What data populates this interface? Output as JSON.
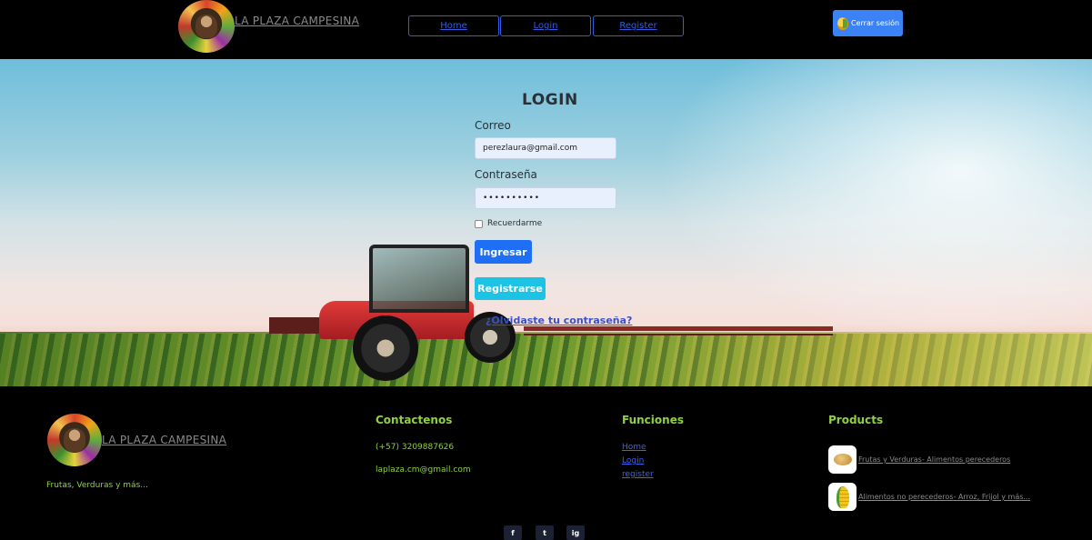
{
  "header": {
    "brand": "LA PLAZA CAMPESINA",
    "nav": {
      "home": "Home",
      "login": "Login",
      "register": "Register"
    },
    "logout_label": "Cerrar sesión"
  },
  "login": {
    "title": "LOGIN",
    "email_label": "Correo",
    "email_value": "perezlaura@gmail.com",
    "password_label": "Contraseña",
    "password_value": "••••••••••",
    "remember_label": "Recuerdarme",
    "submit_label": "Ingresar",
    "register_label": "Registrarse",
    "forgot_label": "¿Olvidaste tu contraseña?"
  },
  "footer": {
    "brand": "LA PLAZA CAMPESINA",
    "tagline": "Frutas, Verduras y más...",
    "contact": {
      "heading": "Contactenos",
      "phone": "(+57) 3209887626",
      "email": "laplaza.cm@gmail.com"
    },
    "functions": {
      "heading": "Funciones",
      "links": [
        "Home",
        "Login",
        "register"
      ]
    },
    "products": {
      "heading": "Products",
      "items": [
        {
          "label": "Frutas y Verduras- Alimentos perecederos",
          "icon": "potato-icon"
        },
        {
          "label": "Alimentos no perecederos- Arroz, Frijol y más...",
          "icon": "corn-icon"
        }
      ]
    },
    "social": {
      "facebook": "f",
      "twitter": "t",
      "instagram": "ig"
    }
  },
  "colors": {
    "accent_blue": "#1e6ff5",
    "cyan": "#1cc3e4",
    "footer_green": "#8ed23e",
    "nav_border": "#2f5fe0"
  }
}
